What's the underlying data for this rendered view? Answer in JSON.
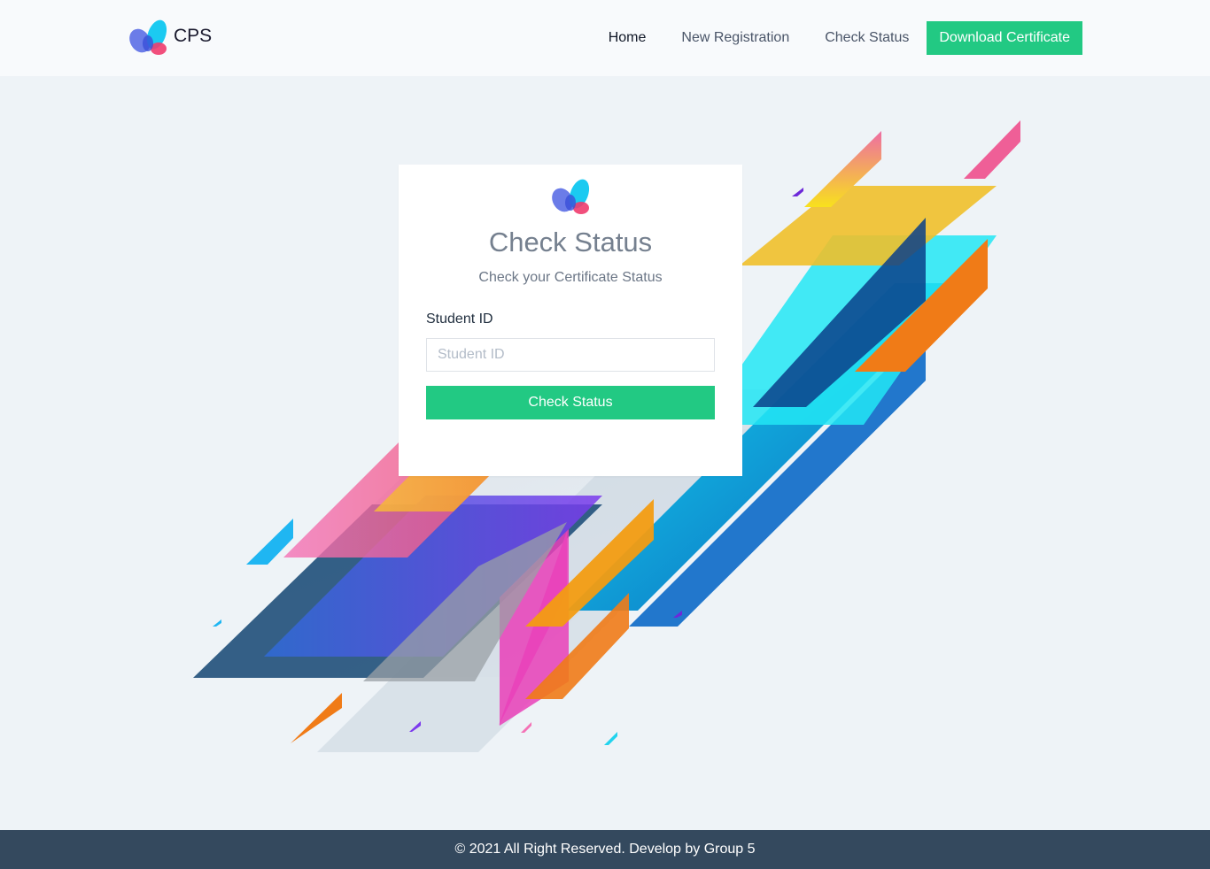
{
  "brand": {
    "name": "CPS",
    "logo_icon": "butterfly-logo-icon"
  },
  "nav": {
    "home": "Home",
    "new_registration": "New Registration",
    "check_status": "Check Status",
    "download_certificate": "Download Certificate"
  },
  "card": {
    "logo_icon": "butterfly-logo-icon",
    "title": "Check Status",
    "subtitle": "Check your Certificate Status",
    "field_label": "Student ID",
    "field_placeholder": "Student ID",
    "field_value": "",
    "submit_label": "Check Status"
  },
  "footer": {
    "text": "© 2021 All Right Reserved. Develop by Group 5"
  },
  "colors": {
    "accent": "#22c983",
    "footer_bg": "#34495e",
    "page_bg": "#eef3f7"
  }
}
